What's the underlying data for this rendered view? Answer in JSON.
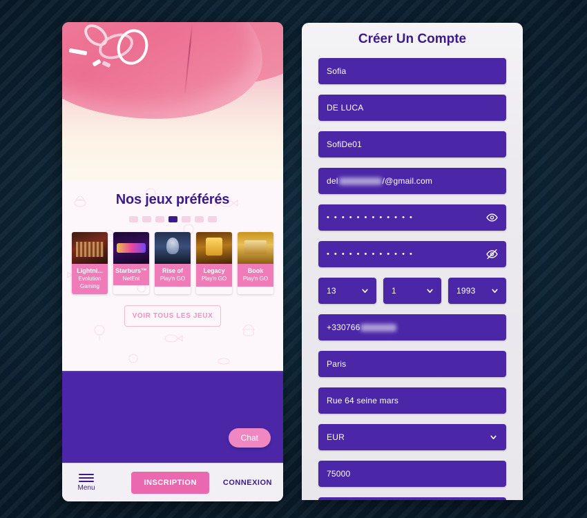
{
  "phone": {
    "games": {
      "title": "Nos jeux préférés",
      "dots_count": 7,
      "active_dot_index": 3,
      "cards": [
        {
          "name": "Lightni...",
          "provider": "Evolution Gaming",
          "thumb": "thumb-lightning"
        },
        {
          "name": "Starburs™",
          "provider": "NetEnt",
          "thumb": "thumb-starburst"
        },
        {
          "name": "Rise of",
          "provider": "Play'n GO",
          "thumb": "thumb-riseof"
        },
        {
          "name": "Legacy",
          "provider": "Play'n GO",
          "thumb": "thumb-legacy"
        },
        {
          "name": "Book",
          "provider": "Play'n GO",
          "thumb": "thumb-book"
        }
      ],
      "all_games_label": "VOIR TOUS LES JEUX"
    },
    "chat_label": "Chat",
    "nav": {
      "menu_label": "Menu",
      "signup_label": "INSCRIPTION",
      "login_label": "CONNEXION"
    }
  },
  "signup": {
    "title": "Créer Un Compte",
    "fields": {
      "firstname": "Sofia",
      "lastname": "DE LUCA",
      "username": "SofiDe01",
      "email_prefix": "del",
      "email_suffix": "/@gmail.com",
      "password": "• • • • • • • • • • • •",
      "password_confirm": "• • • • • • • • • • • •",
      "birth_day": "13",
      "birth_month": "1",
      "birth_year": "1993",
      "phone_prefix": "+330766",
      "city": "Paris",
      "address": "Rue 64 seine mars",
      "currency": "EUR",
      "postcode": "75000"
    },
    "icons": {
      "eye_visible": "eye-icon",
      "eye_hidden": "eye-off-icon",
      "chevron": "chevron-down-icon"
    }
  },
  "colors": {
    "purple": "#4b27a8",
    "deep_purple": "#3b1a8c",
    "pink": "#ef7cb8",
    "pink_button": "#e968b0",
    "background": "#0d2233"
  }
}
